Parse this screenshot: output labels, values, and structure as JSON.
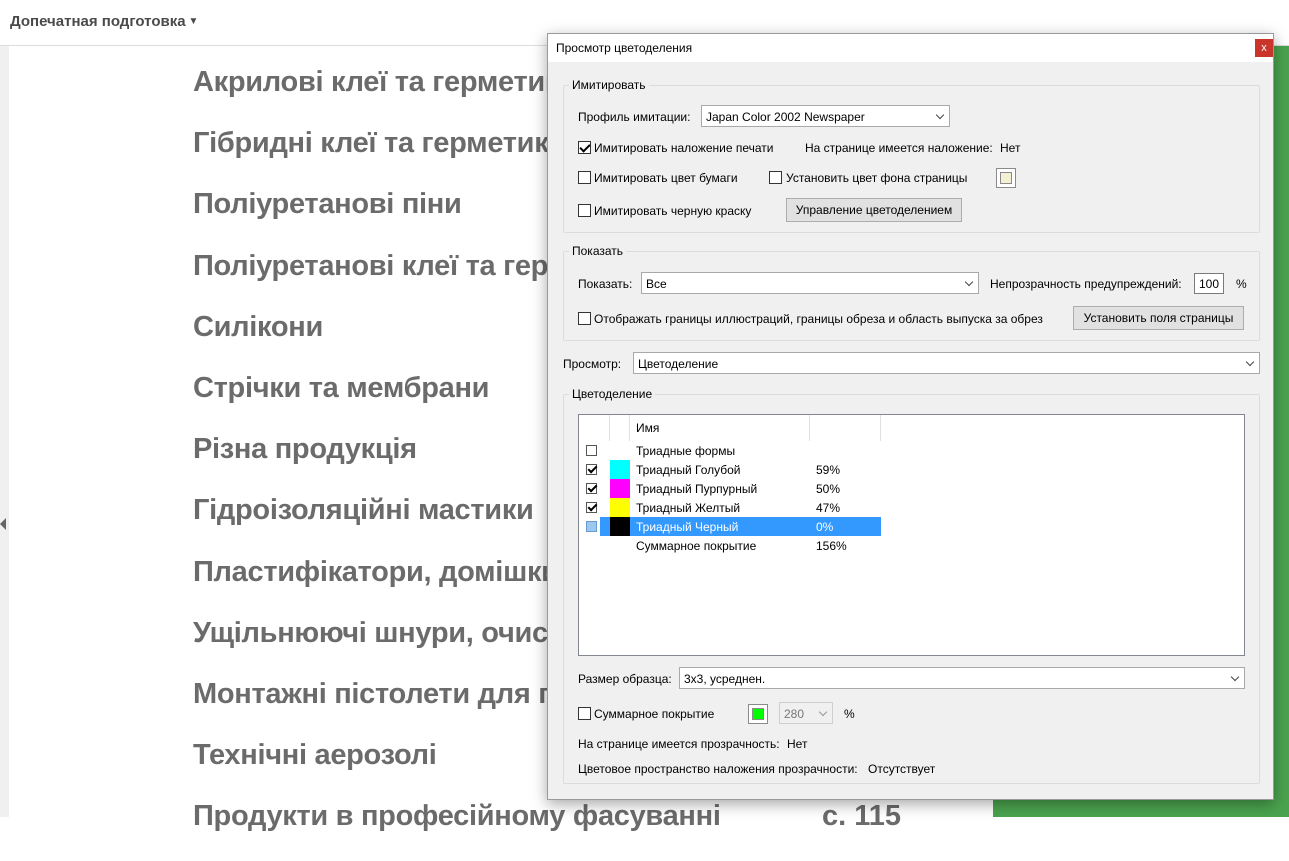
{
  "app": {
    "menu_label": "Допечатная подготовка",
    "doc_items": [
      "Акрилові клеї та герметики",
      "Гібридні клеї та герметики",
      "Поліуретанові піни",
      "Поліуретанові клеї та герметики",
      "Силікони",
      "Стрічки та мембрани",
      "Різна продукція",
      "Гідроізоляційні мастики",
      "Пластифікатори, домішки",
      "Ущільнюючі шнури, очисники",
      "Монтажні пістолети для піни",
      "Технічні аерозолі",
      "Продукти в професійному фасуванні"
    ],
    "doc_page_no": "с. 115"
  },
  "dialog": {
    "title": "Просмотр цветоделения",
    "close_glyph": "x",
    "simulate": {
      "group_label": "Имитировать",
      "profile_label": "Профиль имитации:",
      "profile_value": "Japan Color 2002 Newspaper",
      "overprint_label": "Имитировать наложение печати",
      "overprint_checked": true,
      "page_overprint_label": "На странице имеется наложение:",
      "page_overprint_value": "Нет",
      "paper_color_label": "Имитировать цвет бумаги",
      "page_bg_label": "Установить цвет фона страницы",
      "page_bg_color": "#f3f0d3",
      "black_ink_label": "Имитировать черную краску",
      "manage_button": "Управление цветоделением"
    },
    "show": {
      "group_label": "Показать",
      "show_label": "Показать:",
      "show_value": "Все",
      "opacity_label": "Непрозрачность предупреждений:",
      "opacity_value": "100",
      "percent_sign": "%",
      "boxes_label": "Отображать границы иллюстраций, границы обреза и область выпуска за обрез",
      "page_boxes_button": "Установить поля страницы"
    },
    "preview": {
      "label": "Просмотр:",
      "value": "Цветоделение"
    },
    "separations": {
      "group_label": "Цветоделение",
      "column_name": "Имя",
      "rows": [
        {
          "name": "Триадные формы",
          "percent": "",
          "checked": false,
          "color": "",
          "selected": false
        },
        {
          "name": "Триадный Голубой",
          "percent": "59%",
          "checked": true,
          "color": "#00ffff",
          "selected": false
        },
        {
          "name": "Триадный Пурпурный",
          "percent": "50%",
          "checked": true,
          "color": "#ff00ff",
          "selected": false
        },
        {
          "name": "Триадный Желтый",
          "percent": "47%",
          "checked": true,
          "color": "#ffff00",
          "selected": false
        },
        {
          "name": "Триадный Черный",
          "percent": "0%",
          "checked": false,
          "color": "#000000",
          "selected": true
        },
        {
          "name": "Суммарное покрытие",
          "percent": "156%",
          "checked": null,
          "color": "",
          "selected": false
        }
      ],
      "sample_label": "Размер образца:",
      "sample_value": "3х3, усреднен.",
      "total_coverage_label": "Суммарное покрытие",
      "total_coverage_color": "#00ff00",
      "total_coverage_value": "280",
      "percent_sign": "%",
      "transparency_label": "На странице имеется прозрачность:",
      "transparency_value": "Нет",
      "blend_space_label": "Цветовое пространство наложения прозрачности:",
      "blend_space_value": "Отсутствует"
    }
  },
  "colors": {
    "accent_green": "#4aa34e",
    "selection_blue": "#3399ff",
    "close_red": "#c9352b"
  }
}
